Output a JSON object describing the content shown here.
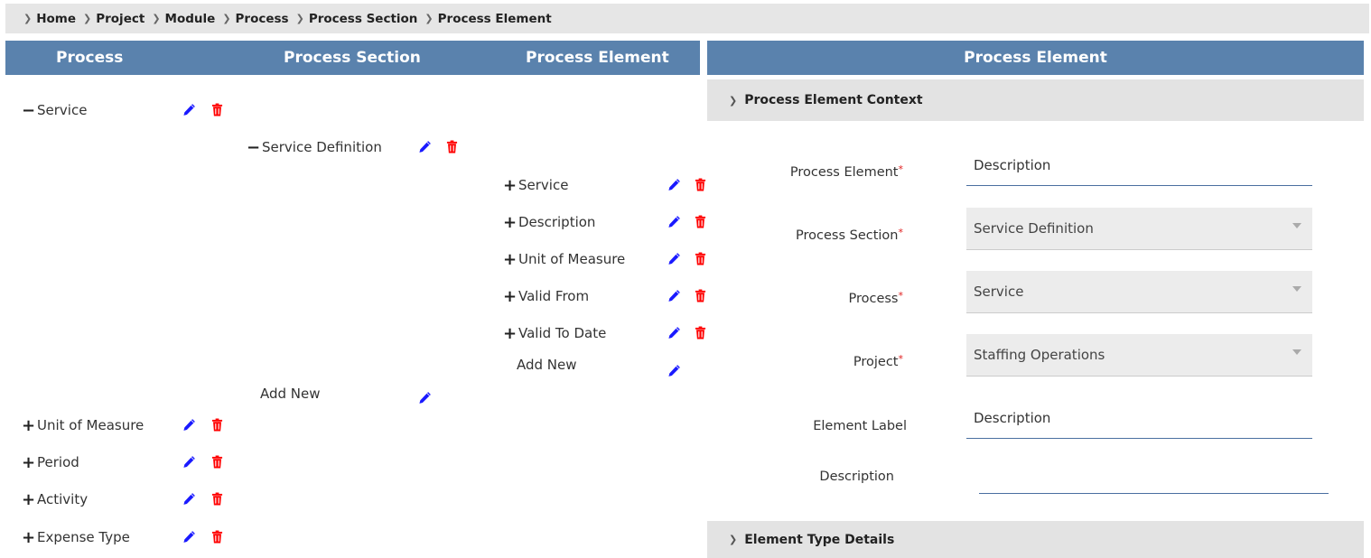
{
  "breadcrumb": [
    "Home",
    "Project",
    "Module",
    "Process",
    "Process Section",
    "Process Element"
  ],
  "tree": {
    "headers": {
      "process": "Process",
      "section": "Process Section",
      "element": "Process Element"
    },
    "processes": [
      {
        "label": "Service",
        "expanded": true
      },
      {
        "label": "Unit of Measure",
        "expanded": false
      },
      {
        "label": "Period",
        "expanded": false
      },
      {
        "label": "Activity",
        "expanded": false
      },
      {
        "label": "Expense Type",
        "expanded": false
      }
    ],
    "section": {
      "label": "Service Definition",
      "expanded": true
    },
    "elements": [
      "Service",
      "Description",
      "Unit of Measure",
      "Valid From",
      "Valid To Date"
    ],
    "add_new_element": "Add New",
    "add_new_section": "Add New",
    "toggle_expanded": "−",
    "toggle_collapsed": "+",
    "icons": {
      "edit": "pencil-icon",
      "delete": "trash-icon"
    },
    "colors": {
      "edit": "#1a1aff",
      "delete": "#ff0000"
    }
  },
  "form": {
    "title": "Process Element",
    "context_section": "Process Element Context",
    "fields": {
      "process_element": {
        "label": "Process Element",
        "value": "Description",
        "required": true
      },
      "process_section": {
        "label": "Process Section",
        "value": "Service Definition",
        "required": true
      },
      "process": {
        "label": "Process",
        "value": "Service",
        "required": true
      },
      "project": {
        "label": "Project",
        "value": "Staffing Operations",
        "required": true
      },
      "element_label": {
        "label": "Element Label",
        "value": "Description",
        "required": false
      },
      "description": {
        "label": "Description",
        "value": "",
        "required": false
      }
    },
    "required_mark": "*",
    "type_section": "Element Type Details"
  },
  "colors": {
    "header": "#5a82ad",
    "breadcrumb_bg": "#e6e6e6",
    "section_bg": "#e3e3e3",
    "field_bg": "#ececec",
    "underline": "#4a6fa0",
    "required": "#e02020"
  }
}
